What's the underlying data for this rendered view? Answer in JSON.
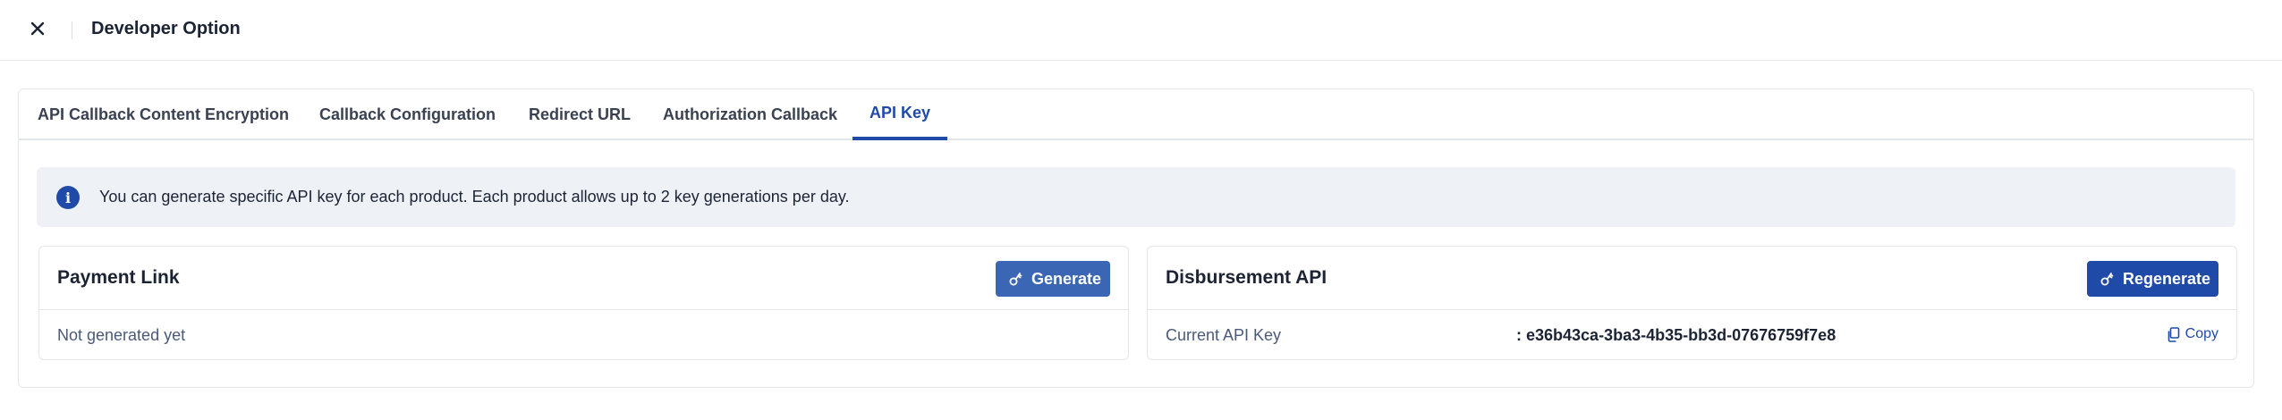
{
  "header": {
    "close_icon": "close-icon",
    "title": "Developer Option"
  },
  "tabs": [
    {
      "label": "API Callback Content Encryption",
      "active": false
    },
    {
      "label": "Callback Configuration",
      "active": false
    },
    {
      "label": "Redirect URL",
      "active": false
    },
    {
      "label": "Authorization Callback",
      "active": false
    },
    {
      "label": "API Key",
      "active": true
    }
  ],
  "info": {
    "icon": "info-icon",
    "text": "You can generate specific API key for each product. Each product allows up to 2 key generations per day."
  },
  "cards": {
    "payment_link": {
      "title": "Payment Link",
      "button_label": "Generate",
      "button_icon": "key-icon",
      "status_text": "Not generated yet"
    },
    "disbursement": {
      "title": "Disbursement API",
      "button_label": "Regenerate",
      "button_icon": "key-icon",
      "key_label": "Current API Key",
      "key_value": ": e36b43ca-3ba3-4b35-bb3d-07676759f7e8",
      "copy_label": "Copy",
      "copy_icon": "copy-icon"
    }
  },
  "colors": {
    "accent": "#1f4aa8",
    "generate_button": "#3b66b3",
    "info_background": "#eef2f7"
  }
}
